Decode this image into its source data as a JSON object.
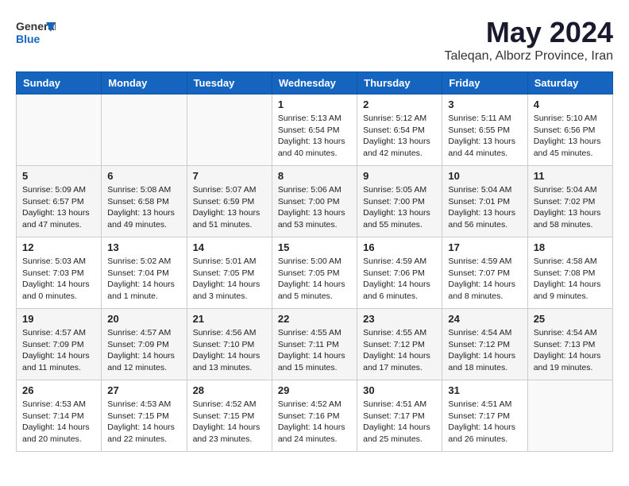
{
  "header": {
    "logo_general": "General",
    "logo_blue": "Blue",
    "month_year": "May 2024",
    "location": "Taleqan, Alborz Province, Iran"
  },
  "days_of_week": [
    "Sunday",
    "Monday",
    "Tuesday",
    "Wednesday",
    "Thursday",
    "Friday",
    "Saturday"
  ],
  "weeks": [
    {
      "cells": [
        {
          "day": "",
          "info": ""
        },
        {
          "day": "",
          "info": ""
        },
        {
          "day": "",
          "info": ""
        },
        {
          "day": "1",
          "info": "Sunrise: 5:13 AM\nSunset: 6:54 PM\nDaylight: 13 hours\nand 40 minutes."
        },
        {
          "day": "2",
          "info": "Sunrise: 5:12 AM\nSunset: 6:54 PM\nDaylight: 13 hours\nand 42 minutes."
        },
        {
          "day": "3",
          "info": "Sunrise: 5:11 AM\nSunset: 6:55 PM\nDaylight: 13 hours\nand 44 minutes."
        },
        {
          "day": "4",
          "info": "Sunrise: 5:10 AM\nSunset: 6:56 PM\nDaylight: 13 hours\nand 45 minutes."
        }
      ]
    },
    {
      "cells": [
        {
          "day": "5",
          "info": "Sunrise: 5:09 AM\nSunset: 6:57 PM\nDaylight: 13 hours\nand 47 minutes."
        },
        {
          "day": "6",
          "info": "Sunrise: 5:08 AM\nSunset: 6:58 PM\nDaylight: 13 hours\nand 49 minutes."
        },
        {
          "day": "7",
          "info": "Sunrise: 5:07 AM\nSunset: 6:59 PM\nDaylight: 13 hours\nand 51 minutes."
        },
        {
          "day": "8",
          "info": "Sunrise: 5:06 AM\nSunset: 7:00 PM\nDaylight: 13 hours\nand 53 minutes."
        },
        {
          "day": "9",
          "info": "Sunrise: 5:05 AM\nSunset: 7:00 PM\nDaylight: 13 hours\nand 55 minutes."
        },
        {
          "day": "10",
          "info": "Sunrise: 5:04 AM\nSunset: 7:01 PM\nDaylight: 13 hours\nand 56 minutes."
        },
        {
          "day": "11",
          "info": "Sunrise: 5:04 AM\nSunset: 7:02 PM\nDaylight: 13 hours\nand 58 minutes."
        }
      ]
    },
    {
      "cells": [
        {
          "day": "12",
          "info": "Sunrise: 5:03 AM\nSunset: 7:03 PM\nDaylight: 14 hours\nand 0 minutes."
        },
        {
          "day": "13",
          "info": "Sunrise: 5:02 AM\nSunset: 7:04 PM\nDaylight: 14 hours\nand 1 minute."
        },
        {
          "day": "14",
          "info": "Sunrise: 5:01 AM\nSunset: 7:05 PM\nDaylight: 14 hours\nand 3 minutes."
        },
        {
          "day": "15",
          "info": "Sunrise: 5:00 AM\nSunset: 7:05 PM\nDaylight: 14 hours\nand 5 minutes."
        },
        {
          "day": "16",
          "info": "Sunrise: 4:59 AM\nSunset: 7:06 PM\nDaylight: 14 hours\nand 6 minutes."
        },
        {
          "day": "17",
          "info": "Sunrise: 4:59 AM\nSunset: 7:07 PM\nDaylight: 14 hours\nand 8 minutes."
        },
        {
          "day": "18",
          "info": "Sunrise: 4:58 AM\nSunset: 7:08 PM\nDaylight: 14 hours\nand 9 minutes."
        }
      ]
    },
    {
      "cells": [
        {
          "day": "19",
          "info": "Sunrise: 4:57 AM\nSunset: 7:09 PM\nDaylight: 14 hours\nand 11 minutes."
        },
        {
          "day": "20",
          "info": "Sunrise: 4:57 AM\nSunset: 7:09 PM\nDaylight: 14 hours\nand 12 minutes."
        },
        {
          "day": "21",
          "info": "Sunrise: 4:56 AM\nSunset: 7:10 PM\nDaylight: 14 hours\nand 13 minutes."
        },
        {
          "day": "22",
          "info": "Sunrise: 4:55 AM\nSunset: 7:11 PM\nDaylight: 14 hours\nand 15 minutes."
        },
        {
          "day": "23",
          "info": "Sunrise: 4:55 AM\nSunset: 7:12 PM\nDaylight: 14 hours\nand 17 minutes."
        },
        {
          "day": "24",
          "info": "Sunrise: 4:54 AM\nSunset: 7:12 PM\nDaylight: 14 hours\nand 18 minutes."
        },
        {
          "day": "25",
          "info": "Sunrise: 4:54 AM\nSunset: 7:13 PM\nDaylight: 14 hours\nand 19 minutes."
        }
      ]
    },
    {
      "cells": [
        {
          "day": "26",
          "info": "Sunrise: 4:53 AM\nSunset: 7:14 PM\nDaylight: 14 hours\nand 20 minutes."
        },
        {
          "day": "27",
          "info": "Sunrise: 4:53 AM\nSunset: 7:15 PM\nDaylight: 14 hours\nand 22 minutes."
        },
        {
          "day": "28",
          "info": "Sunrise: 4:52 AM\nSunset: 7:15 PM\nDaylight: 14 hours\nand 23 minutes."
        },
        {
          "day": "29",
          "info": "Sunrise: 4:52 AM\nSunset: 7:16 PM\nDaylight: 14 hours\nand 24 minutes."
        },
        {
          "day": "30",
          "info": "Sunrise: 4:51 AM\nSunset: 7:17 PM\nDaylight: 14 hours\nand 25 minutes."
        },
        {
          "day": "31",
          "info": "Sunrise: 4:51 AM\nSunset: 7:17 PM\nDaylight: 14 hours\nand 26 minutes."
        },
        {
          "day": "",
          "info": ""
        }
      ]
    }
  ]
}
